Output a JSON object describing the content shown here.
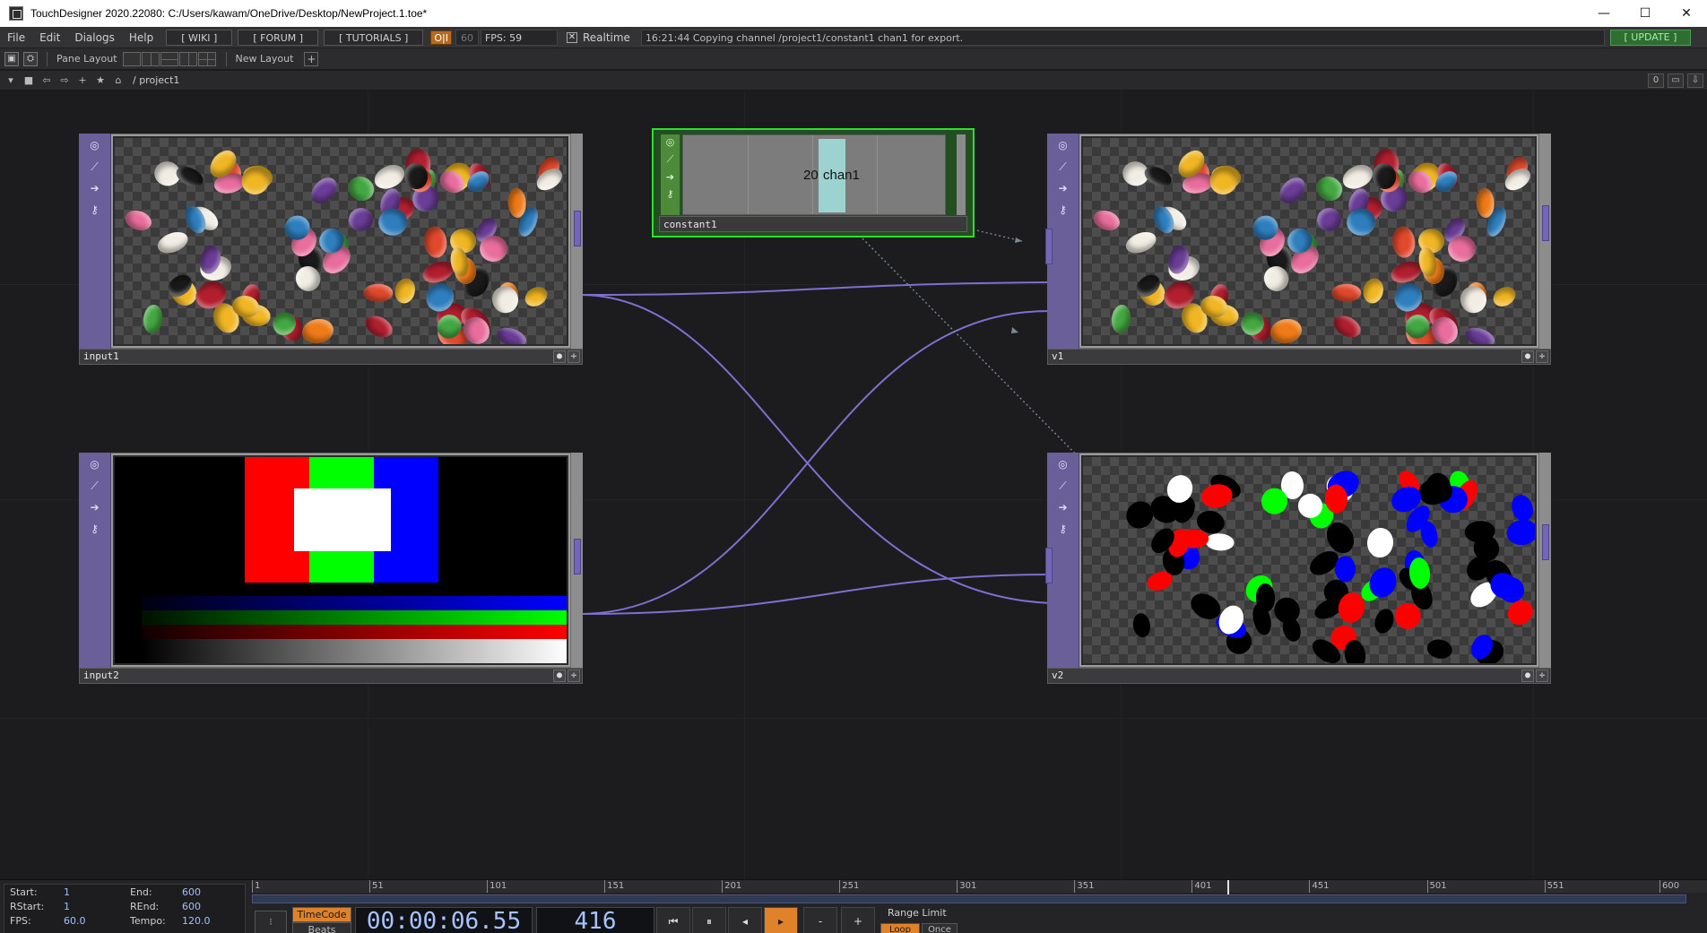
{
  "window": {
    "title": "TouchDesigner 2020.22080: C:/Users/kawam/OneDrive/Desktop/NewProject.1.toe*",
    "minimize": "—",
    "maximize": "☐",
    "close": "✕"
  },
  "menubar": {
    "items": [
      "File",
      "Edit",
      "Dialogs",
      "Help"
    ],
    "links": [
      "[ WIKI ]",
      "[ FORUM ]",
      "[ TUTORIALS ]"
    ],
    "oi": "O|I",
    "sixty": "60",
    "fps": "FPS:  59",
    "realtime_label": "Realtime",
    "status": "16:21:44 Copying channel /project1/constant1 chan1 for export.",
    "update": "[ UPDATE ]"
  },
  "toolbar": {
    "pane_layout": "Pane Layout",
    "new_layout": "New Layout"
  },
  "pathbar": {
    "path": "/ project1",
    "zero": "0"
  },
  "nodes": {
    "input1": "input1",
    "input2": "input2",
    "v1": "v1",
    "v2": "v2",
    "constant1": {
      "label": "constant1",
      "value": "20",
      "channel": "chan1"
    }
  },
  "colors": {
    "top_family": "#6a5f98",
    "chop_family": "#4d8a3a",
    "chop_highlight": "#2ee02e",
    "wire": "#7e6fd1",
    "timecode": "#e0822a",
    "update_green": "#2f6d33"
  },
  "timeline": {
    "ticks": [
      "1",
      "51",
      "101",
      "151",
      "201",
      "251",
      "301",
      "351",
      "401",
      "451",
      "501",
      "551",
      "600"
    ],
    "current_frame_value": 416,
    "range_end": 600,
    "start_label": "Start:",
    "start": "1",
    "end_label": "End:",
    "end": "600",
    "rstart_label": "RStart:",
    "rstart": "1",
    "rend_label": "REnd:",
    "rend": "600",
    "fps_label": "FPS:",
    "fps": "60.0",
    "tempo_label": "Tempo:",
    "tempo": "120.0",
    "timecode_btn": "TimeCode",
    "beats_btn": "Beats",
    "timecode": "00:00:06.55",
    "frame": "416",
    "range_limit": "Range Limit",
    "loop": "Loop",
    "once": "Once",
    "transport": [
      "⏮",
      "⏸",
      "◂",
      "▸",
      "-",
      "+"
    ],
    "dot": "⁝"
  }
}
